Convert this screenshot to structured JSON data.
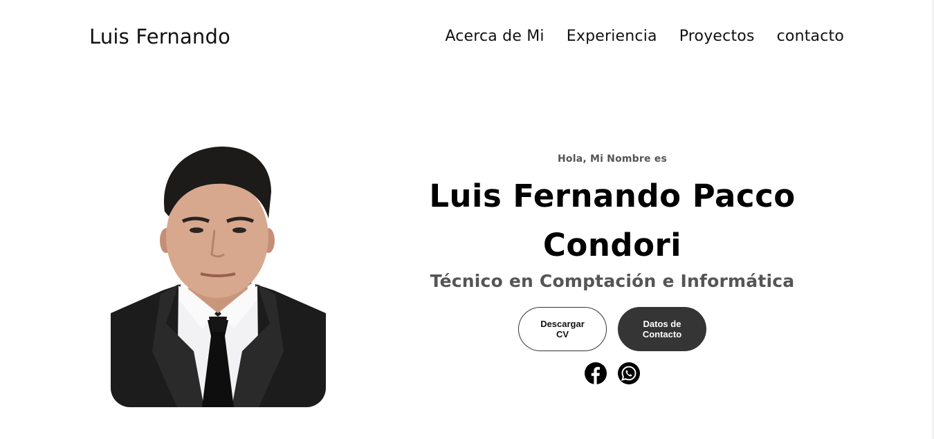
{
  "header": {
    "logo": "Luis Fernando",
    "nav": [
      "Acerca de Mi",
      "Experiencia",
      "Proyectos",
      "contacto"
    ]
  },
  "hero": {
    "greeting": "Hola, Mi Nombre es",
    "name": "Luis Fernando Pacco Condori",
    "profession": "Técnico en Comptación e Informática",
    "buttons": {
      "cv": "Descargar CV",
      "contact": "Datos de Contacto"
    },
    "socials": [
      "facebook-icon",
      "whatsapp-icon"
    ]
  },
  "colors": {
    "text": "#000000",
    "muted": "#555555",
    "button_dark": "#353535"
  }
}
